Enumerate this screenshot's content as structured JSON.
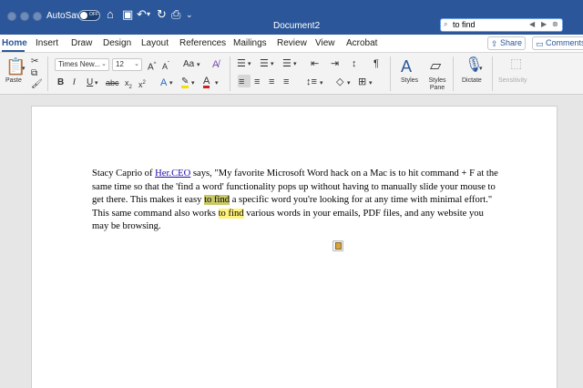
{
  "titlebar": {
    "autosave_label": "AutoSave",
    "autosave_state": "OFF",
    "document_title": "Document2",
    "search_value": "to find"
  },
  "tabs": {
    "items": [
      "Home",
      "Insert",
      "Draw",
      "Design",
      "Layout",
      "References",
      "Mailings",
      "Review",
      "View",
      "Acrobat"
    ],
    "active": "Home",
    "share_label": "Share",
    "comments_label": "Comments"
  },
  "ribbon": {
    "paste_label": "Paste",
    "font_name": "Times New...",
    "font_size": "12",
    "styles_label": "Styles",
    "styles_pane_label": "Styles Pane",
    "dictate_label": "Dictate",
    "sensitivity_label": "Sensitivity"
  },
  "document": {
    "p1": "Stacy Caprio of ",
    "link": "Her.CEO",
    "p2": " says, \"My favorite Microsoft Word hack on a Mac is to hit command + F at the same time so that the 'find a word' functionality pops up without having to manually slide your mouse to get there. This makes it easy ",
    "match1": "to find",
    "p3": " a specific word you're looking for at any time with minimal effort.\" This same command also works ",
    "match2": "to find",
    "p4": " various words in your emails, PDF files, and any website you may be browsing."
  },
  "colors": {
    "titlebar": "#2b579a",
    "current_match": "#c9c86a",
    "match": "#fff27a",
    "link": "#1a0dab"
  }
}
